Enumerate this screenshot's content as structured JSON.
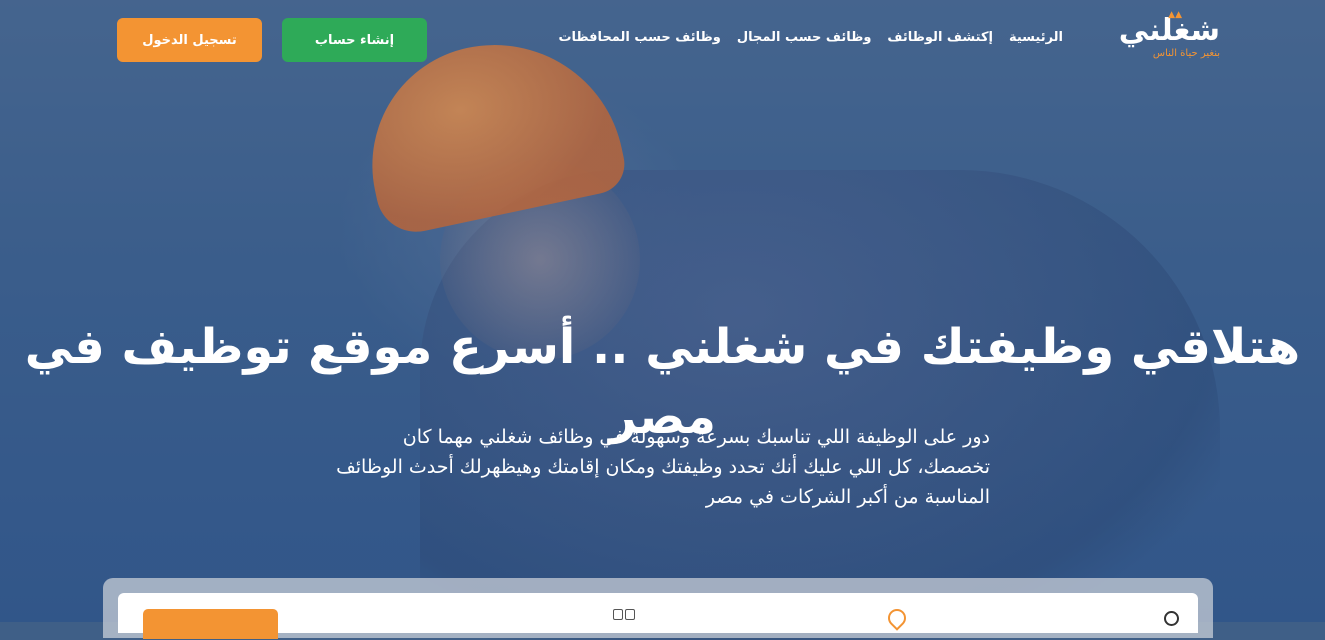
{
  "brand": {
    "name": "شغلني",
    "tagline": "بنغير حياة الناس"
  },
  "nav": {
    "items": [
      {
        "label": "الرئيسية"
      },
      {
        "label": "إكتشف الوظائف"
      },
      {
        "label": "وظائف حسب المجال"
      },
      {
        "label": "وظائف حسب المحافظات"
      }
    ]
  },
  "auth": {
    "register_label": "إنشاء حساب",
    "login_label": "تسجيل الدخول"
  },
  "hero": {
    "title": "هتلاقي وظيفتك في شغلني .. أسرع موقع توظيف في مصر",
    "subtitle": "دور على الوظيفة اللي تناسبك بسرعة وسهولة في وظائف شغلني مهما كان تخصصك، كل اللي عليك أنك تحدد وظيفتك ومكان إقامتك وهيظهرلك أحدث الوظائف المناسبة من أكبر الشركات في مصر"
  },
  "colors": {
    "accent_orange": "#f39433",
    "accent_green": "#2eaa58",
    "hero_overlay": "#3d6090"
  },
  "icons": [
    "search-icon",
    "location-pin-icon",
    "category-grid-icon"
  ]
}
